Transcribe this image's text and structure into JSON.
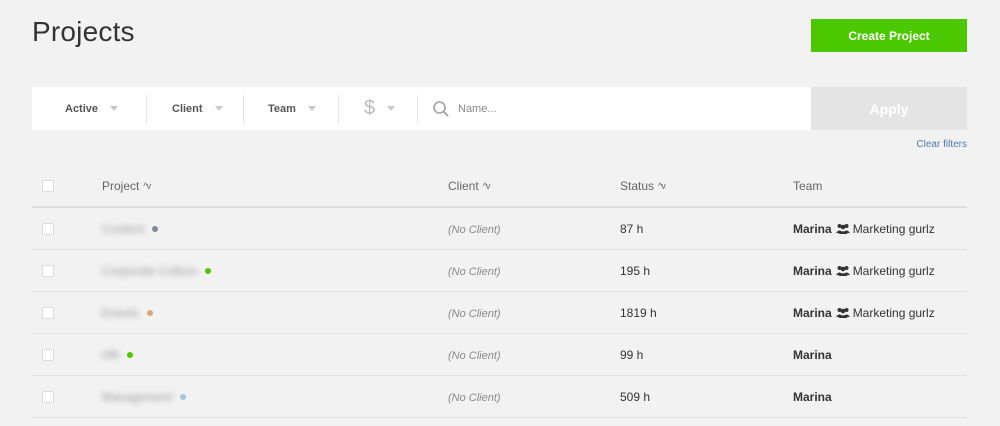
{
  "header": {
    "title": "Projects",
    "create_label": "Create Project"
  },
  "filters": {
    "status_label": "Active",
    "client_label": "Client",
    "team_label": "Team",
    "billable_label": "$",
    "search_placeholder": "Name...",
    "apply_label": "Apply",
    "clear_label": "Clear filters"
  },
  "table": {
    "columns": {
      "project": "Project",
      "client": "Client",
      "status": "Status",
      "team": "Team"
    },
    "rows": [
      {
        "name": "Content",
        "dot_color": "#7a8aa0",
        "client": "(No Client)",
        "status": "87 h",
        "owner": "Marina",
        "group": "Marketing gurlz"
      },
      {
        "name": "Corporate Culture",
        "dot_color": "#4bc800",
        "client": "(No Client)",
        "status": "195 h",
        "owner": "Marina",
        "group": "Marketing gurlz"
      },
      {
        "name": "Events",
        "dot_color": "#d8a878",
        "client": "(No Client)",
        "status": "1819 h",
        "owner": "Marina",
        "group": "Marketing gurlz"
      },
      {
        "name": "HR",
        "dot_color": "#4bc800",
        "client": "(No Client)",
        "status": "99 h",
        "owner": "Marina",
        "group": ""
      },
      {
        "name": "Management",
        "dot_color": "#a8c4e0",
        "client": "(No Client)",
        "status": "509 h",
        "owner": "Marina",
        "group": ""
      }
    ]
  },
  "colors": {
    "accent": "#4bc800",
    "link": "#4a7ab0",
    "apply_disabled": "#e4e4e4"
  }
}
